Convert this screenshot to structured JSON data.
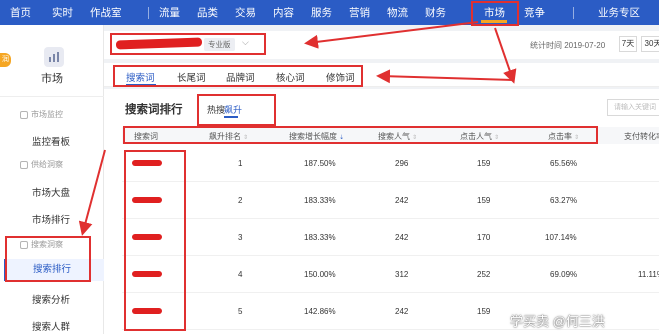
{
  "topnav": {
    "items": [
      "首页",
      "实时",
      "作战室",
      "流量",
      "品类",
      "交易",
      "内容",
      "服务",
      "营销",
      "物流",
      "财务",
      "市场",
      "竞争",
      "业务专区"
    ],
    "active": "市场"
  },
  "sidebar": {
    "badge": "润",
    "title": "市场",
    "groups": [
      {
        "label": "市场监控",
        "items": [
          "监控看板"
        ]
      },
      {
        "label": "供给洞察",
        "items": [
          "市场大盘",
          "市场排行"
        ]
      },
      {
        "label": "搜索洞察",
        "items": [
          "搜索排行",
          "搜索分析",
          "搜索人群"
        ]
      }
    ],
    "active_item": "搜索排行"
  },
  "header": {
    "shop_badge": "专业版",
    "stat_time": "统计时间 2019-07-20",
    "ranges": [
      "7天",
      "30天"
    ]
  },
  "tabs": {
    "items": [
      "搜索词",
      "长尾词",
      "品牌词",
      "核心词",
      "修饰词"
    ],
    "active": "搜索词"
  },
  "panel": {
    "title": "搜索词排行",
    "toggles": [
      "热搜",
      "飙升"
    ],
    "active_toggle": "飙升",
    "search_placeholder": "请输入关键词"
  },
  "table": {
    "columns": [
      "搜索词",
      "飙升排名",
      "搜索增长幅度",
      "搜索人气",
      "点击人气",
      "点击率",
      "支付转化率"
    ],
    "rows": [
      {
        "rank": "1",
        "growth": "187.50%",
        "search_pop": "296",
        "click_pop": "159",
        "ctr": "65.56%",
        "conv": ""
      },
      {
        "rank": "2",
        "growth": "183.33%",
        "search_pop": "242",
        "click_pop": "159",
        "ctr": "63.27%",
        "conv": ""
      },
      {
        "rank": "3",
        "growth": "183.33%",
        "search_pop": "242",
        "click_pop": "170",
        "ctr": "107.14%",
        "conv": ""
      },
      {
        "rank": "4",
        "growth": "150.00%",
        "search_pop": "312",
        "click_pop": "252",
        "ctr": "69.09%",
        "conv": "11.11%"
      },
      {
        "rank": "5",
        "growth": "142.86%",
        "search_pop": "242",
        "click_pop": "159",
        "ctr": "",
        "conv": ""
      }
    ]
  },
  "watermark": "学买卖 @何三洪",
  "colors": {
    "nav": "#2b5cc5",
    "accent": "#2b5cc5",
    "annotation": "#e03030",
    "market_underline": "#f5a623"
  }
}
